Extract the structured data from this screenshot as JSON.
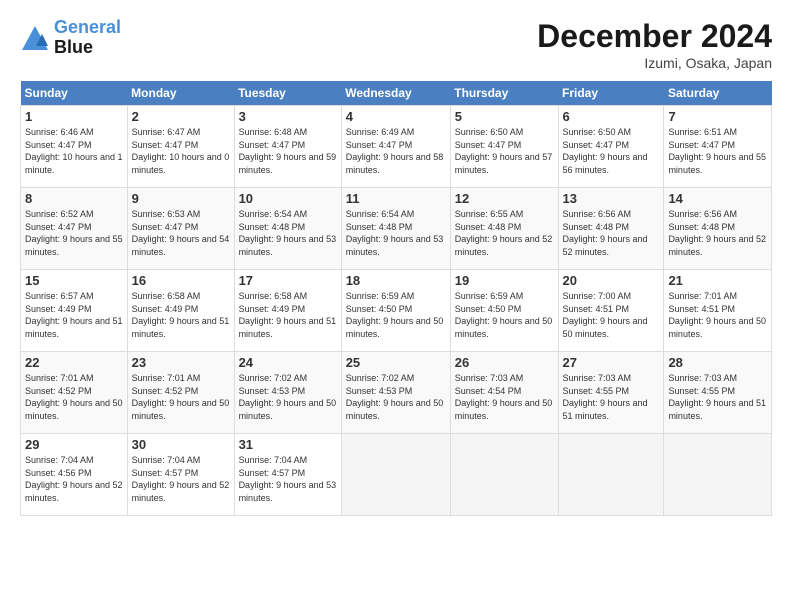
{
  "logo": {
    "line1": "General",
    "line2": "Blue"
  },
  "title": "December 2024",
  "location": "Izumi, Osaka, Japan",
  "days_of_week": [
    "Sunday",
    "Monday",
    "Tuesday",
    "Wednesday",
    "Thursday",
    "Friday",
    "Saturday"
  ],
  "weeks": [
    [
      {
        "day": 1,
        "sunrise": "6:46 AM",
        "sunset": "4:47 PM",
        "daylight": "10 hours and 1 minute."
      },
      {
        "day": 2,
        "sunrise": "6:47 AM",
        "sunset": "4:47 PM",
        "daylight": "10 hours and 0 minutes."
      },
      {
        "day": 3,
        "sunrise": "6:48 AM",
        "sunset": "4:47 PM",
        "daylight": "9 hours and 59 minutes."
      },
      {
        "day": 4,
        "sunrise": "6:49 AM",
        "sunset": "4:47 PM",
        "daylight": "9 hours and 58 minutes."
      },
      {
        "day": 5,
        "sunrise": "6:50 AM",
        "sunset": "4:47 PM",
        "daylight": "9 hours and 57 minutes."
      },
      {
        "day": 6,
        "sunrise": "6:50 AM",
        "sunset": "4:47 PM",
        "daylight": "9 hours and 56 minutes."
      },
      {
        "day": 7,
        "sunrise": "6:51 AM",
        "sunset": "4:47 PM",
        "daylight": "9 hours and 55 minutes."
      }
    ],
    [
      {
        "day": 8,
        "sunrise": "6:52 AM",
        "sunset": "4:47 PM",
        "daylight": "9 hours and 55 minutes."
      },
      {
        "day": 9,
        "sunrise": "6:53 AM",
        "sunset": "4:47 PM",
        "daylight": "9 hours and 54 minutes."
      },
      {
        "day": 10,
        "sunrise": "6:54 AM",
        "sunset": "4:48 PM",
        "daylight": "9 hours and 53 minutes."
      },
      {
        "day": 11,
        "sunrise": "6:54 AM",
        "sunset": "4:48 PM",
        "daylight": "9 hours and 53 minutes."
      },
      {
        "day": 12,
        "sunrise": "6:55 AM",
        "sunset": "4:48 PM",
        "daylight": "9 hours and 52 minutes."
      },
      {
        "day": 13,
        "sunrise": "6:56 AM",
        "sunset": "4:48 PM",
        "daylight": "9 hours and 52 minutes."
      },
      {
        "day": 14,
        "sunrise": "6:56 AM",
        "sunset": "4:48 PM",
        "daylight": "9 hours and 52 minutes."
      }
    ],
    [
      {
        "day": 15,
        "sunrise": "6:57 AM",
        "sunset": "4:49 PM",
        "daylight": "9 hours and 51 minutes."
      },
      {
        "day": 16,
        "sunrise": "6:58 AM",
        "sunset": "4:49 PM",
        "daylight": "9 hours and 51 minutes."
      },
      {
        "day": 17,
        "sunrise": "6:58 AM",
        "sunset": "4:49 PM",
        "daylight": "9 hours and 51 minutes."
      },
      {
        "day": 18,
        "sunrise": "6:59 AM",
        "sunset": "4:50 PM",
        "daylight": "9 hours and 50 minutes."
      },
      {
        "day": 19,
        "sunrise": "6:59 AM",
        "sunset": "4:50 PM",
        "daylight": "9 hours and 50 minutes."
      },
      {
        "day": 20,
        "sunrise": "7:00 AM",
        "sunset": "4:51 PM",
        "daylight": "9 hours and 50 minutes."
      },
      {
        "day": 21,
        "sunrise": "7:01 AM",
        "sunset": "4:51 PM",
        "daylight": "9 hours and 50 minutes."
      }
    ],
    [
      {
        "day": 22,
        "sunrise": "7:01 AM",
        "sunset": "4:52 PM",
        "daylight": "9 hours and 50 minutes."
      },
      {
        "day": 23,
        "sunrise": "7:01 AM",
        "sunset": "4:52 PM",
        "daylight": "9 hours and 50 minutes."
      },
      {
        "day": 24,
        "sunrise": "7:02 AM",
        "sunset": "4:53 PM",
        "daylight": "9 hours and 50 minutes."
      },
      {
        "day": 25,
        "sunrise": "7:02 AM",
        "sunset": "4:53 PM",
        "daylight": "9 hours and 50 minutes."
      },
      {
        "day": 26,
        "sunrise": "7:03 AM",
        "sunset": "4:54 PM",
        "daylight": "9 hours and 50 minutes."
      },
      {
        "day": 27,
        "sunrise": "7:03 AM",
        "sunset": "4:55 PM",
        "daylight": "9 hours and 51 minutes."
      },
      {
        "day": 28,
        "sunrise": "7:03 AM",
        "sunset": "4:55 PM",
        "daylight": "9 hours and 51 minutes."
      }
    ],
    [
      {
        "day": 29,
        "sunrise": "7:04 AM",
        "sunset": "4:56 PM",
        "daylight": "9 hours and 52 minutes."
      },
      {
        "day": 30,
        "sunrise": "7:04 AM",
        "sunset": "4:57 PM",
        "daylight": "9 hours and 52 minutes."
      },
      {
        "day": 31,
        "sunrise": "7:04 AM",
        "sunset": "4:57 PM",
        "daylight": "9 hours and 53 minutes."
      },
      null,
      null,
      null,
      null
    ]
  ]
}
